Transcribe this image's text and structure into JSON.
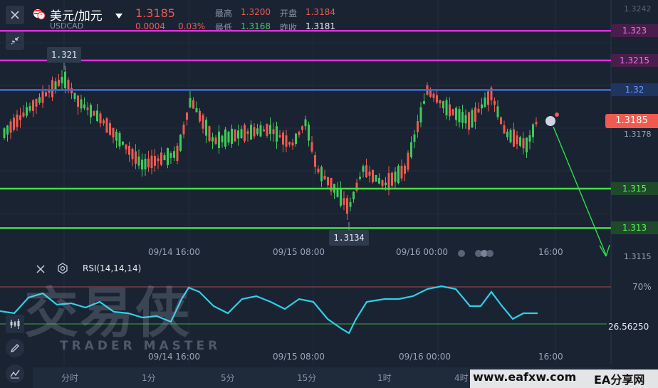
{
  "header": {
    "title": "美元/加元",
    "symbol": "USDCAD",
    "price": "1.3185",
    "change": "0.0004",
    "change_pct": "0.03%",
    "high_label": "最高",
    "high": "1.3200",
    "low_label": "最低",
    "low": "1.3168",
    "open_label": "开盘",
    "open": "1.3184",
    "prev_close_label": "昨收",
    "prev_close": "1.3181"
  },
  "price_axis": {
    "top_label": "1.3242",
    "current_price": "1.3185",
    "prev_value": "1.3178",
    "bottom_label": "1.3115"
  },
  "levels": [
    {
      "label": "1.323",
      "color": "#e02ee0"
    },
    {
      "label": "1.3215",
      "color": "#e02ee0"
    },
    {
      "label": "1.32",
      "color": "#3a6fe0"
    },
    {
      "label": "1.315",
      "color": "#44dd44"
    },
    {
      "label": "1.313",
      "color": "#44dd44"
    }
  ],
  "callouts": {
    "high": "1.321",
    "low": "1.3134"
  },
  "time_labels": [
    "09/14 16:00",
    "09/15 08:00",
    "09/16 00:00",
    "16:00"
  ],
  "rsi": {
    "title": "RSI(14,14,14)",
    "upper_label": "70%",
    "lower_value": "26.56250",
    "line_color": "#2fd0e8"
  },
  "timeframes": [
    "分时",
    "1分",
    "5分",
    "15分",
    "1时",
    "4时"
  ],
  "watermark": {
    "main": "交易侠",
    "sub": "TRADER MASTER",
    "site": "www.eafxw.com",
    "brand": "EA分享网"
  },
  "colors": {
    "up": "#3ecb5a",
    "down": "#f05a4f",
    "background": "#1a2332"
  }
}
